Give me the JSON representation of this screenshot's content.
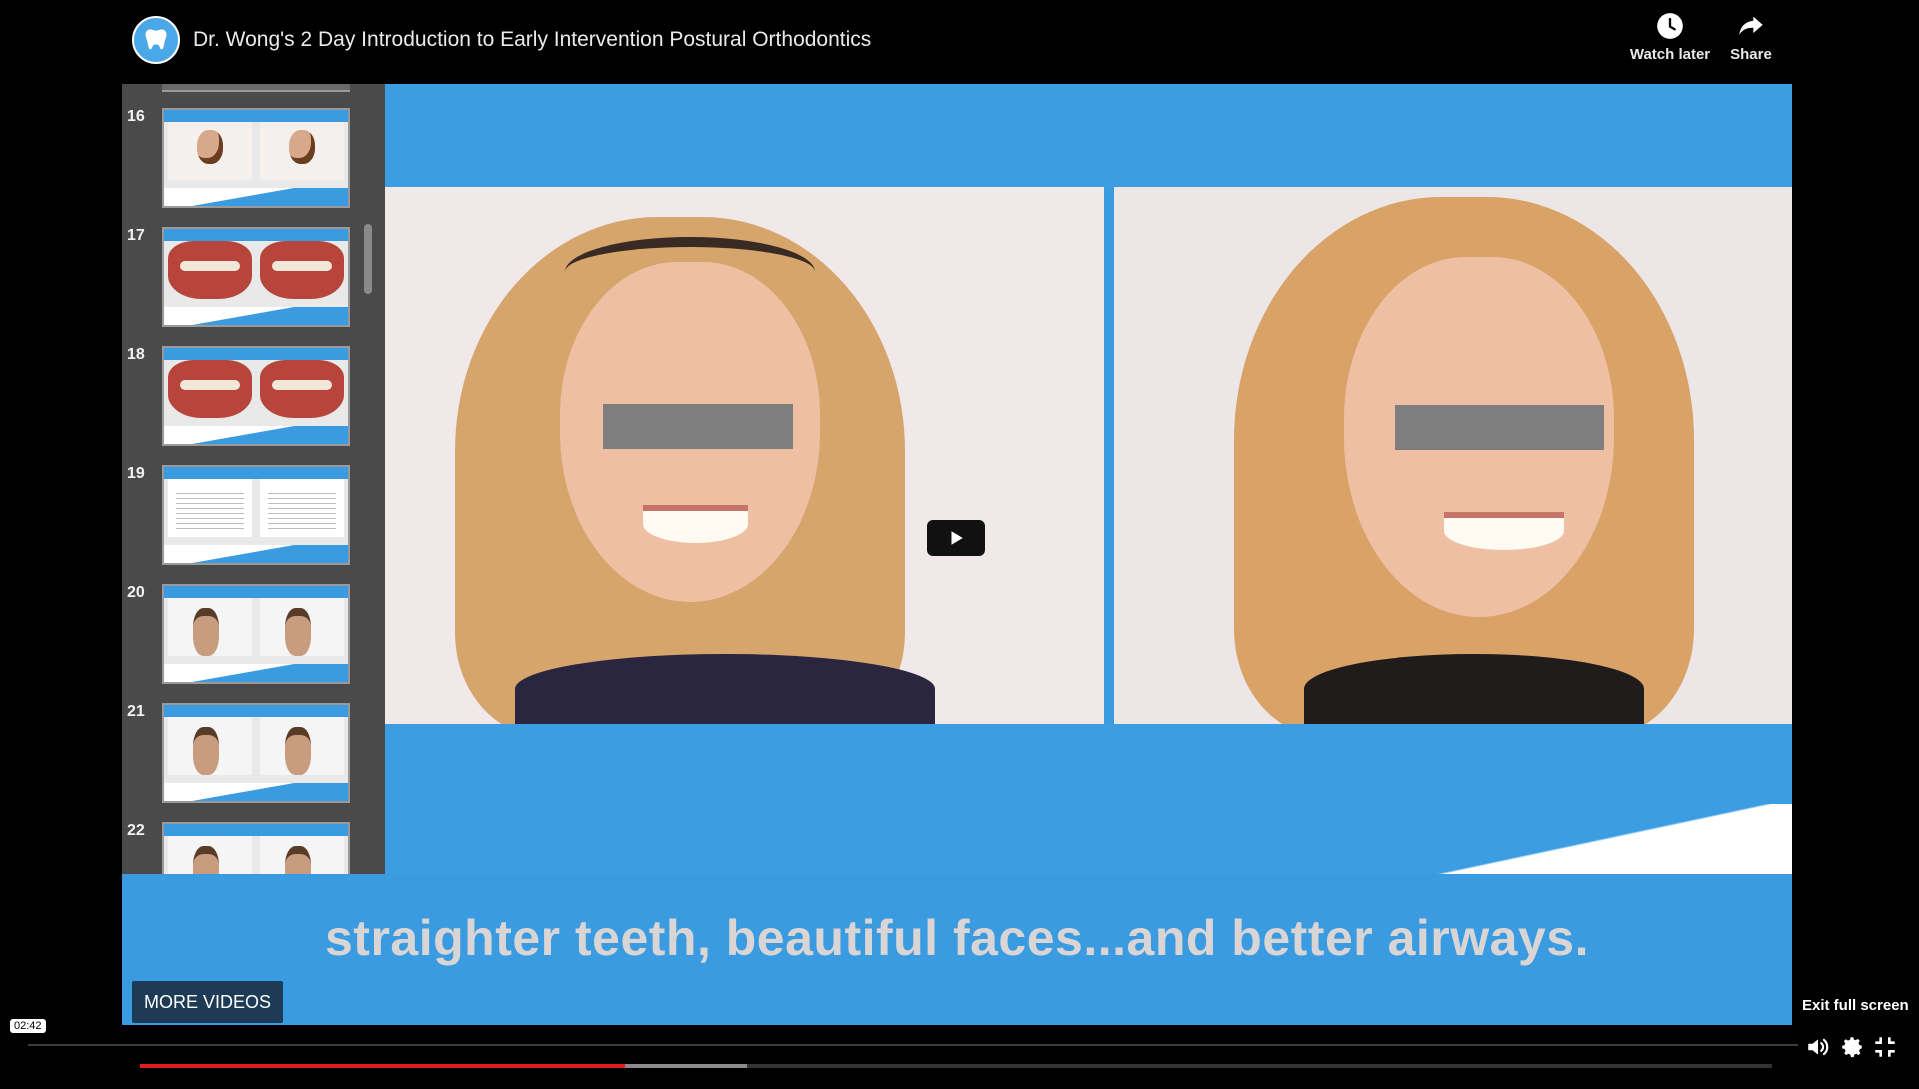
{
  "title_bar": {
    "title": "Dr. Wong's 2 Day Introduction to Early Intervention Postural Orthodontics",
    "watch_later_label": "Watch later",
    "share_label": "Share"
  },
  "thumbnails": [
    {
      "number": "16",
      "kind": "face-profile"
    },
    {
      "number": "17",
      "kind": "teeth-upper"
    },
    {
      "number": "18",
      "kind": "teeth-lower"
    },
    {
      "number": "19",
      "kind": "document"
    },
    {
      "number": "20",
      "kind": "child-front"
    },
    {
      "number": "21",
      "kind": "child-profile"
    },
    {
      "number": "22",
      "kind": "child-front"
    }
  ],
  "slide": {
    "caption": "straighter teeth, beautiful faces...and better airways."
  },
  "player": {
    "more_videos_label": "MORE VIDEOS",
    "current_time": "02:42",
    "exit_fullscreen_label": "Exit full screen",
    "played_fraction": 0.297,
    "buffered_fraction": 0.372
  },
  "icons": {
    "channel": "tooth-logo-icon",
    "watch_later": "clock-icon",
    "share": "share-arrow-icon",
    "play": "play-icon",
    "volume": "volume-icon",
    "settings": "gear-icon",
    "exit_fullscreen": "exit-fullscreen-icon"
  },
  "colors": {
    "slide_blue": "#3a9be0",
    "progress_red": "#e11d1d"
  }
}
